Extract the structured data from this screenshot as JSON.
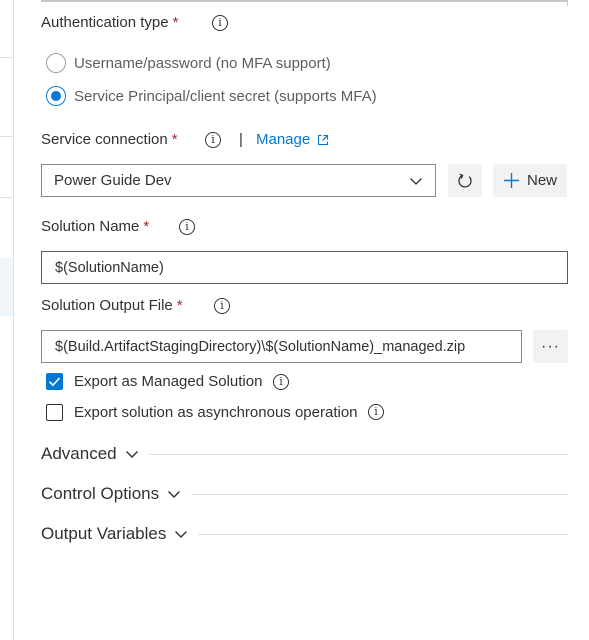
{
  "auth": {
    "label": "Authentication type",
    "required": "*",
    "options": [
      {
        "label": "Username/password (no MFA support)",
        "checked": false
      },
      {
        "label": "Service Principal/client secret (supports MFA)",
        "checked": true
      }
    ]
  },
  "service_connection": {
    "label": "Service connection",
    "required": "*",
    "separator": "|",
    "manage_label": "Manage",
    "selected": "Power Guide Dev",
    "new_label": "New"
  },
  "solution_name": {
    "label": "Solution Name",
    "required": "*",
    "value": "$(SolutionName)"
  },
  "solution_output": {
    "label": "Solution Output File",
    "required": "*",
    "value": "$(Build.ArtifactStagingDirectory)\\$(SolutionName)_managed.zip",
    "browse_label": "···"
  },
  "checkboxes": {
    "managed": {
      "label": "Export as Managed Solution",
      "checked": true
    },
    "async": {
      "label": "Export solution as asynchronous operation",
      "checked": false
    }
  },
  "sections": {
    "advanced": "Advanced",
    "control_options": "Control Options",
    "output_variables": "Output Variables"
  },
  "icons": {
    "info": "info-icon",
    "refresh": "refresh-icon",
    "add": "plus-icon",
    "external": "external-link-icon",
    "chevron": "chevron-down-icon",
    "check": "checkmark-icon"
  },
  "colors": {
    "accent": "#0078d4",
    "required": "#a4262c",
    "button_bg": "#f3f2f1"
  }
}
